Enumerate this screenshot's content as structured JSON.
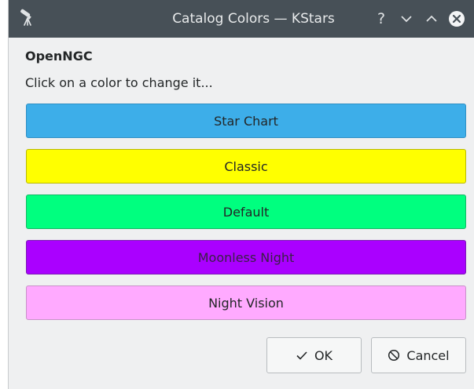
{
  "window": {
    "title": "Catalog Colors — KStars",
    "help_glyph": "?"
  },
  "catalog": {
    "name": "OpenNGC",
    "instructions": "Click on a color to change it..."
  },
  "color_schemes": [
    {
      "label": "Star Chart",
      "color": "#3daee9"
    },
    {
      "label": "Classic",
      "color": "#ffff00"
    },
    {
      "label": "Default",
      "color": "#00ff7f"
    },
    {
      "label": "Moonless Night",
      "color": "#aa00ff"
    },
    {
      "label": "Night Vision",
      "color": "#ffaaff"
    }
  ],
  "dialog_buttons": {
    "ok_label": "OK",
    "ok_icon": "checkmark-icon",
    "cancel_label": "Cancel",
    "cancel_icon": "cancel-icon"
  },
  "colors": {
    "titlebar": "#475057",
    "window_bg": "#eff0f1",
    "text": "#232627"
  }
}
